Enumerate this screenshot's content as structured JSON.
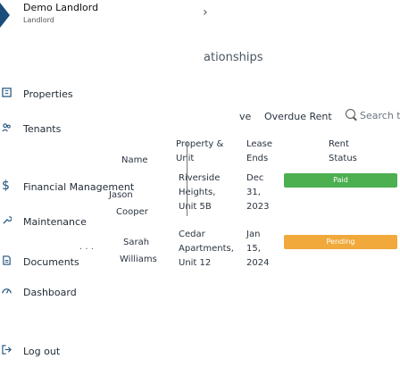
{
  "menu": {
    "user_name": "Demo Landlord",
    "user_role": "Landlord",
    "items": [
      {
        "label": "Properties",
        "icon": "building-icon"
      },
      {
        "label": "Tenants",
        "icon": "people-icon"
      },
      {
        "label": "Financial Management",
        "icon": "dollar-icon"
      },
      {
        "label": "Maintenance",
        "icon": "wrench-icon"
      },
      {
        "label": "Documents",
        "icon": "document-icon"
      },
      {
        "label": "Dashboard",
        "icon": "dashboard-icon"
      },
      {
        "label": "Log out",
        "icon": "logout-icon"
      }
    ],
    "chevron": "›"
  },
  "page": {
    "heading_fragment": "ationships",
    "tabs": [
      "ve",
      "Overdue Rent"
    ],
    "search_placeholder": "Search t",
    "columns": [
      "Name",
      "Property &",
      "Unit",
      "Lease",
      "Ends",
      "Rent",
      "Status"
    ],
    "rows": [
      {
        "name_first": "Jason",
        "name_last": "Cooper",
        "property": [
          "Riverside",
          "Heights,",
          "Unit 5B"
        ],
        "lease_ends": [
          "Dec",
          "31,",
          "2023"
        ],
        "status": "Paid"
      },
      {
        "name_first": "Sarah",
        "name_last": "Williams",
        "property": [
          "Cedar",
          "Apartments,",
          "Unit 12"
        ],
        "lease_ends": [
          "Jan",
          "15,",
          "2024"
        ],
        "status": "Pending"
      }
    ],
    "row_more": "· · ·"
  },
  "colors": {
    "accent": "#1a4d7a",
    "paid": "#4caf50",
    "pending": "#f0a93a"
  }
}
